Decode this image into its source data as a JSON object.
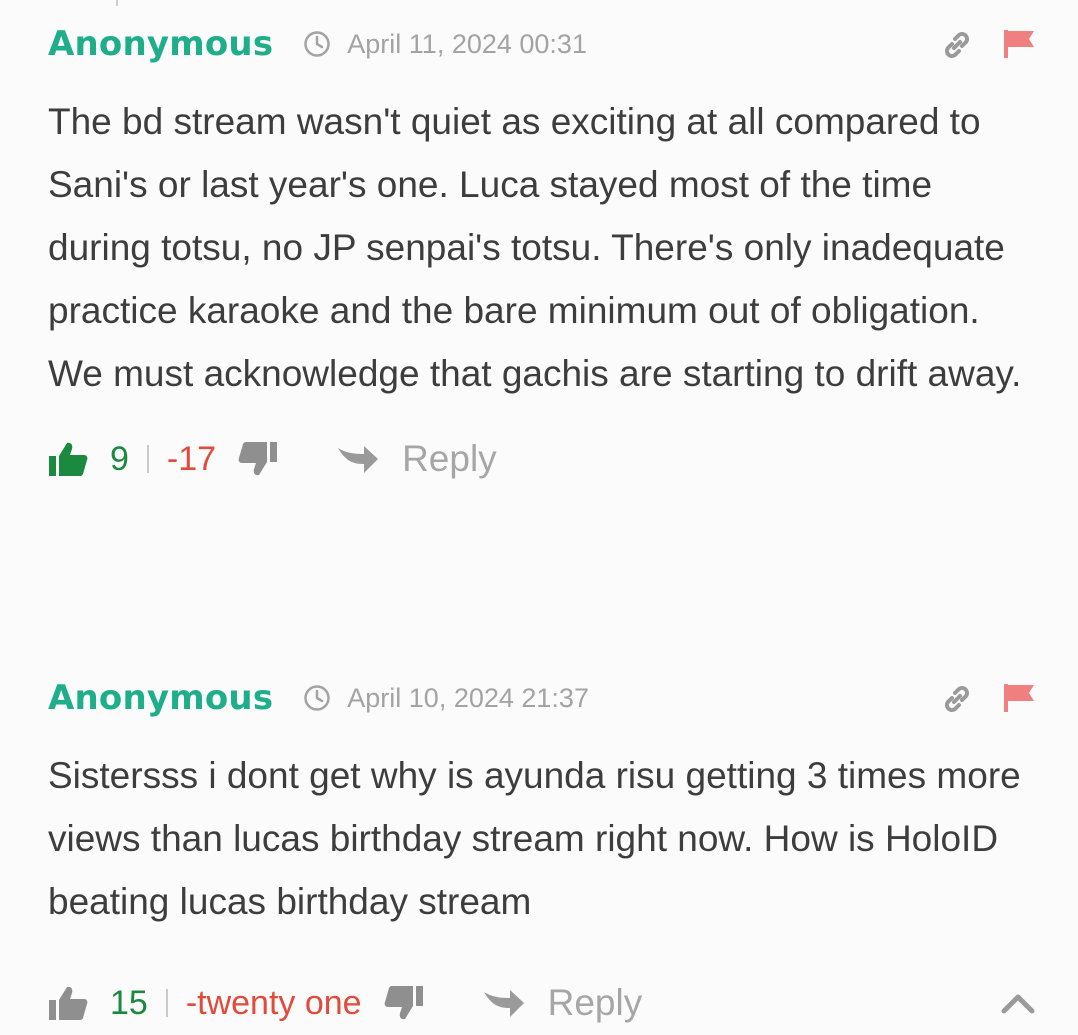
{
  "colors": {
    "author": "#1fae8a",
    "up_active": "#1b8a3e",
    "up_inactive": "#8f8f8f",
    "down": "#e04b3b",
    "flag": "#f07f7f",
    "muted": "#a3a3a3"
  },
  "comments": [
    {
      "author": "Anonymous",
      "timestamp": "April 11, 2024 00:31",
      "text": "The bd stream wasn't quiet as exciting at all compared to Sani's or last year's one. Luca stayed most of the time during totsu, no JP senpai's totsu. There's only inadequate practice karaoke and the bare minimum out of obligation.\nWe must acknowledge that gachis are starting to drift away.",
      "upvotes": "9",
      "downvotes": "-17",
      "reply_label": "Reply",
      "upvote_active": true,
      "icons": [
        "clock-icon",
        "link-icon",
        "flag-icon",
        "thumbs-up-icon",
        "thumbs-down-icon",
        "reply-arrow-icon"
      ]
    },
    {
      "author": "Anonymous",
      "timestamp": "April 10, 2024 21:37",
      "text": "Sistersss i dont get why is ayunda risu getting 3 times more views than lucas birthday stream right now. How is HoloID beating lucas birthday stream",
      "upvotes": "15",
      "downvotes": "-twenty one",
      "reply_label": "Reply",
      "upvote_active": false,
      "icons": [
        "clock-icon",
        "link-icon",
        "flag-icon",
        "thumbs-up-icon",
        "thumbs-down-icon",
        "reply-arrow-icon",
        "chevron-up-icon"
      ]
    }
  ]
}
